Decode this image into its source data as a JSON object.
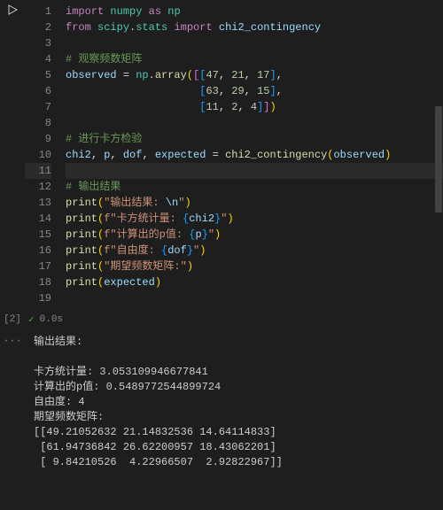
{
  "cell": {
    "exec_count_label": "[2]",
    "run_time": "0.0s",
    "lines": [
      {
        "n": 1,
        "html": "<span class='tk-kw'>import</span> <span class='tk-mod'>numpy</span> <span class='tk-kw'>as</span> <span class='tk-mod'>np</span>"
      },
      {
        "n": 2,
        "html": "<span class='tk-kw'>from</span> <span class='tk-mod'>scipy</span><span class='tk-op'>.</span><span class='tk-mod'>stats</span> <span class='tk-kw'>import</span> <span class='tk-id'>chi2_contingency</span>"
      },
      {
        "n": 3,
        "html": ""
      },
      {
        "n": 4,
        "html": "<span class='tk-cmt'># 观察频数矩阵</span>"
      },
      {
        "n": 5,
        "html": "<span class='tk-id'>observed</span> <span class='tk-op'>=</span> <span class='tk-mod'>np</span><span class='tk-op'>.</span><span class='tk-fn'>array</span><span class='tk-brk1'>(</span><span class='tk-brk2'>[</span><span class='tk-brk3'>[</span><span class='tk-num'>47</span><span class='tk-op'>,</span> <span class='tk-num'>21</span><span class='tk-op'>,</span> <span class='tk-num'>17</span><span class='tk-brk3'>]</span><span class='tk-op'>,</span>"
      },
      {
        "n": 6,
        "html": "                     <span class='tk-brk3'>[</span><span class='tk-num'>63</span><span class='tk-op'>,</span> <span class='tk-num'>29</span><span class='tk-op'>,</span> <span class='tk-num'>15</span><span class='tk-brk3'>]</span><span class='tk-op'>,</span>"
      },
      {
        "n": 7,
        "html": "                     <span class='tk-brk3'>[</span><span class='tk-num'>11</span><span class='tk-op'>,</span> <span class='tk-num'>2</span><span class='tk-op'>,</span> <span class='tk-num'>4</span><span class='tk-brk3'>]</span><span class='tk-brk2'>]</span><span class='tk-brk1'>)</span>"
      },
      {
        "n": 8,
        "html": ""
      },
      {
        "n": 9,
        "html": "<span class='tk-cmt'># 进行卡方检验</span>"
      },
      {
        "n": 10,
        "html": "<span class='tk-id'>chi2</span><span class='tk-op'>,</span> <span class='tk-id'>p</span><span class='tk-op'>,</span> <span class='tk-id'>dof</span><span class='tk-op'>,</span> <span class='tk-id'>expected</span> <span class='tk-op'>=</span> <span class='tk-fn'>chi2_contingency</span><span class='tk-brk1'>(</span><span class='tk-id'>observed</span><span class='tk-brk1'>)</span>"
      },
      {
        "n": 11,
        "html": "",
        "cursor": true
      },
      {
        "n": 12,
        "html": "<span class='tk-cmt'># 输出结果</span>"
      },
      {
        "n": 13,
        "html": "<span class='tk-fn'>print</span><span class='tk-brk1'>(</span><span class='tk-str'>\"输出结果: </span><span class='tk-id'>\\n</span><span class='tk-str'>\"</span><span class='tk-brk1'>)</span>"
      },
      {
        "n": 14,
        "html": "<span class='tk-fn'>print</span><span class='tk-brk1'>(</span><span class='tk-str'>f\"卡方统计量: </span><span class='tk-brk3'>{</span><span class='tk-id'>chi2</span><span class='tk-brk3'>}</span><span class='tk-str'>\"</span><span class='tk-brk1'>)</span>"
      },
      {
        "n": 15,
        "html": "<span class='tk-fn'>print</span><span class='tk-brk1'>(</span><span class='tk-str'>f\"计算出的p值: </span><span class='tk-brk3'>{</span><span class='tk-id'>p</span><span class='tk-brk3'>}</span><span class='tk-str'>\"</span><span class='tk-brk1'>)</span>"
      },
      {
        "n": 16,
        "html": "<span class='tk-fn'>print</span><span class='tk-brk1'>(</span><span class='tk-str'>f\"自由度: </span><span class='tk-brk3'>{</span><span class='tk-id'>dof</span><span class='tk-brk3'>}</span><span class='tk-str'>\"</span><span class='tk-brk1'>)</span>"
      },
      {
        "n": 17,
        "html": "<span class='tk-fn'>print</span><span class='tk-brk1'>(</span><span class='tk-str'>\"期望频数矩阵:\"</span><span class='tk-brk1'>)</span>"
      },
      {
        "n": 18,
        "html": "<span class='tk-fn'>print</span><span class='tk-brk1'>(</span><span class='tk-id'>expected</span><span class='tk-brk1'>)</span>"
      },
      {
        "n": 19,
        "html": ""
      }
    ]
  },
  "output": {
    "ellipsis": "···",
    "text": "输出结果: \n\n卡方统计量: 3.053109946677841\n计算出的p值: 0.5489772544899724\n自由度: 4\n期望频数矩阵:\n[[49.21052632 21.14832536 14.64114833]\n [61.94736842 26.62200957 18.43062201]\n [ 9.84210526  4.22966507  2.92822967]]"
  }
}
